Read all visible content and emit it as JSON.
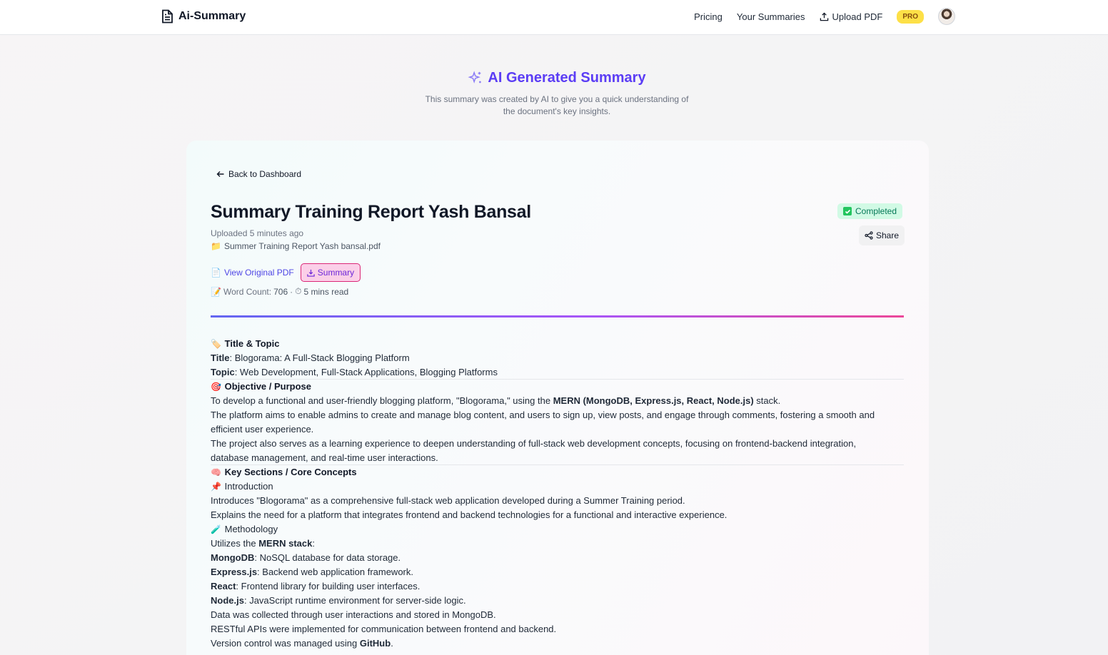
{
  "nav": {
    "brand": "Ai-Summary",
    "links": [
      "Pricing",
      "Your Summaries",
      "Upload PDF"
    ],
    "pro_badge": "PRO"
  },
  "hero": {
    "title": "AI Generated Summary",
    "subtitle_line1": "This summary was created by AI to give you a quick understanding of",
    "subtitle_line2": "the document's key insights."
  },
  "doc": {
    "back_label": "Back to Dashboard",
    "title": "Summary Training Report Yash Bansal",
    "uploaded": "Uploaded 5 minutes ago",
    "file_icon": "📁",
    "file_name": "Summer Training Report Yash bansal.pdf",
    "view_pdf_icon": "📄",
    "view_pdf_label": "View Original PDF",
    "summary_btn_label": "Summary",
    "stats_icon": "📝",
    "word_count_label": "Word Count:",
    "word_count": "706",
    "stats_sep": "·",
    "read_icon": "⏱",
    "read_time": "5 mins read",
    "status": "Completed",
    "share_label": "Share"
  },
  "summary": {
    "s1_icon": "🏷️",
    "s1_title": "Title & Topic",
    "title_label": "Title",
    "title_value": ": Blogorama: A Full-Stack Blogging Platform",
    "topic_label": "Topic",
    "topic_value": ": Web Development, Full-Stack Applications, Blogging Platforms",
    "s2_icon": "🎯",
    "s2_title": "Objective / Purpose",
    "obj1_a": "To develop a functional and user-friendly blogging platform, \"Blogorama,\" using the ",
    "obj1_b": "MERN (MongoDB, Express.js, React, Node.js)",
    "obj1_c": " stack.",
    "obj2_a": "The platform aims to enable admins to create and manage blog content, and users to sign up, view posts, and engage through comments, fostering a smooth and",
    "obj2_b": "efficient user experience.",
    "obj3_a": "The project also serves as a learning experience to deepen understanding of full-stack web development concepts, focusing on frontend-backend integration,",
    "obj3_b": "database management, and real-time user interactions.",
    "s3_icon": "🧠",
    "s3_title": "Key Sections / Core Concepts",
    "intro_icon": "📌",
    "intro_title": "Introduction",
    "intro1": "Introduces \"Blogorama\" as a comprehensive full-stack web application developed during a Summer Training period.",
    "intro2": "Explains the need for a platform that integrates frontend and backend technologies for a functional and interactive experience.",
    "meth_icon": "🧪",
    "meth_title": "Methodology",
    "meth1_a": "Utilizes the ",
    "meth1_b": "MERN stack",
    "meth1_c": ":",
    "mongo_label": "MongoDB",
    "mongo_value": ": NoSQL database for data storage.",
    "express_label": "Express.js",
    "express_value": ": Backend web application framework.",
    "react_label": "React",
    "react_value": ": Frontend library for building user interfaces.",
    "node_label": "Node.js",
    "node_value": ": JavaScript runtime environment for server-side logic.",
    "data_line": "Data was collected through user interactions and stored in MongoDB.",
    "rest_line": "RESTful APIs were implemented for communication between frontend and backend.",
    "vc_a": "Version control was managed using ",
    "vc_b": "GitHub",
    "vc_c": "."
  },
  "colors": {
    "accent": "#5b3df5",
    "link": "#4f46e5",
    "completed_bg": "#d1fae5",
    "pro_bg": "#fde047"
  }
}
